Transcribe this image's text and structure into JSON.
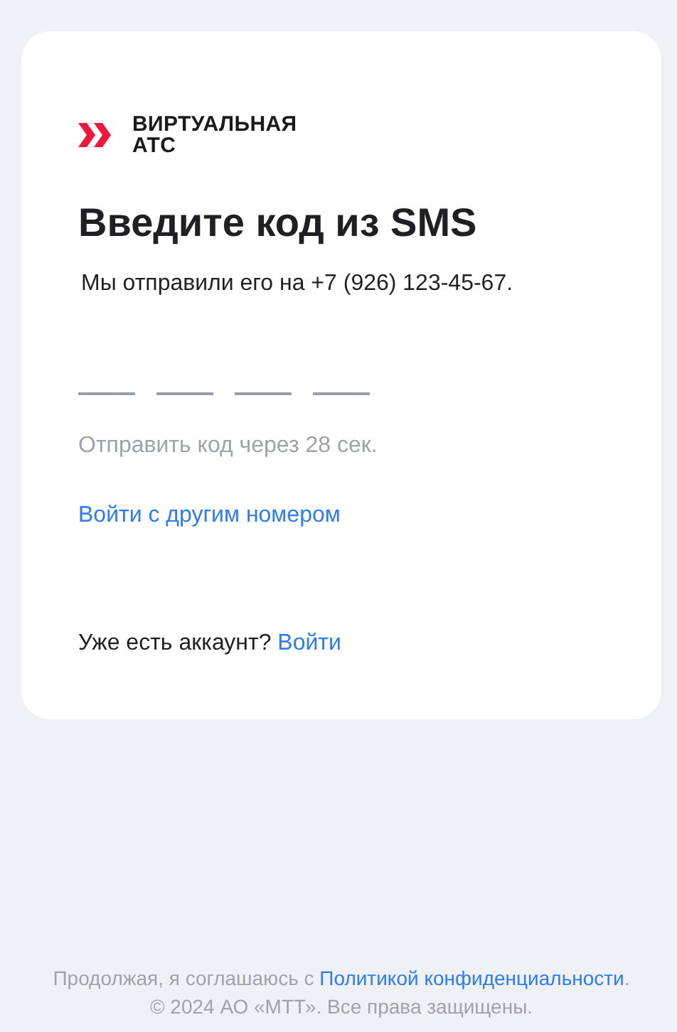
{
  "logo": {
    "line_1": "ВИРТУАЛЬНАЯ",
    "line_2": "АТС"
  },
  "title": "Введите код из SMS",
  "subtitle": "Мы отправили его на +7 (926) 123-45-67.",
  "code_fields": [
    {
      "filled": false
    },
    {
      "filled": false
    },
    {
      "filled": false
    },
    {
      "filled": false
    }
  ],
  "resend_timer": "Отправить код через 28 сек.",
  "other_number_link": "Войти с другим номером",
  "account": {
    "text": "Уже есть аккаунт?",
    "link": "Войти"
  },
  "footer": {
    "consent_before": "Продолжая, я соглашаюсь с",
    "consent_link": "Политикой конфиденциальности",
    "consent_after": ".",
    "copyright": "© 2024 АО «МТТ». Все права защищены."
  }
}
